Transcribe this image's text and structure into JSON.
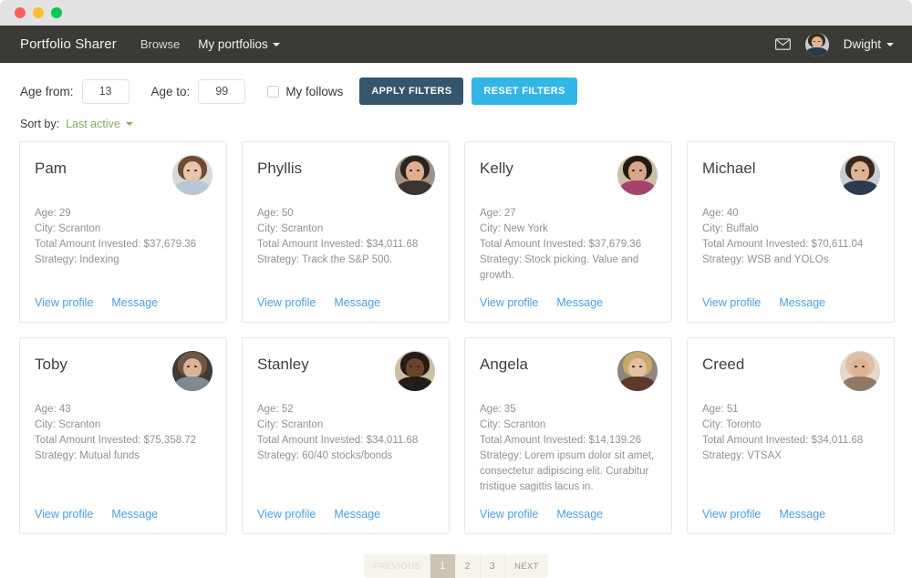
{
  "window": {
    "traffic_lights": [
      "close",
      "minimize",
      "maximize"
    ],
    "chrome_color": "#e2e2e2"
  },
  "navbar": {
    "brand": "Portfolio Sharer",
    "links": [
      {
        "label": "Browse",
        "dropdown": false
      },
      {
        "label": "My portfolios",
        "dropdown": true
      }
    ],
    "mail_icon": "envelope-icon",
    "user": "Dwight",
    "background": "#3b3a35"
  },
  "filters": {
    "age_from_label": "Age from:",
    "age_from_value": "13",
    "age_to_label": "Age to:",
    "age_to_value": "99",
    "my_follows_label": "My follows",
    "my_follows_checked": false,
    "apply_label": "APPLY FILTERS",
    "reset_label": "RESET FILTERS",
    "apply_color": "#34566f",
    "reset_color": "#33b5e5"
  },
  "sort": {
    "label": "Sort by:",
    "value": "Last active",
    "value_color": "#8aab5d"
  },
  "card_labels": {
    "view_profile": "View profile",
    "message": "Message",
    "link_color": "#4a9fe0"
  },
  "profiles": [
    {
      "name": "Pam",
      "age": "Age: 29",
      "city": "City: Scranton",
      "invested": "Total Amount Invested: $37,679.36",
      "strategy": "Strategy: Indexing",
      "avatar": {
        "hair": "#6e4b34",
        "skin": "#e8c4a8",
        "body": "#b9c6d6",
        "bg": "#d7dcd2"
      }
    },
    {
      "name": "Phyllis",
      "age": "Age: 50",
      "city": "City: Scranton",
      "invested": "Total Amount Invested: $34,011.68",
      "strategy": "Strategy: Track the S&P 500.",
      "avatar": {
        "hair": "#2a2320",
        "skin": "#dfae8f",
        "body": "#3b3330",
        "bg": "#9e9384"
      }
    },
    {
      "name": "Kelly",
      "age": "Age: 27",
      "city": "City: New York",
      "invested": "Total Amount Invested: $37,679.36",
      "strategy": "Strategy: Stock picking. Value and growth.",
      "avatar": {
        "hair": "#241a15",
        "skin": "#d7a588",
        "body": "#a4436d",
        "bg": "#cdbfa7"
      }
    },
    {
      "name": "Michael",
      "age": "Age: 40",
      "city": "City: Buffalo",
      "invested": "Total Amount Invested: $70,611.04",
      "strategy": "Strategy: WSB and YOLOs",
      "avatar": {
        "hair": "#3a2a1e",
        "skin": "#e0b494",
        "body": "#2d3a4d",
        "bg": "#c9cdd2"
      }
    },
    {
      "name": "Toby",
      "age": "Age: 43",
      "city": "City: Scranton",
      "invested": "Total Amount Invested: $75,358.72",
      "strategy": "Strategy: Mutual funds",
      "avatar": {
        "hair": "#6b5743",
        "skin": "#dcb295",
        "body": "#7e8a93",
        "bg": "#3f3a33"
      }
    },
    {
      "name": "Stanley",
      "age": "Age: 52",
      "city": "City: Scranton",
      "invested": "Total Amount Invested: $34,011.68",
      "strategy": "Strategy: 60/40 stocks/bonds",
      "avatar": {
        "hair": "#241c16",
        "skin": "#6d4428",
        "body": "#221d1a",
        "bg": "#cdbda4"
      }
    },
    {
      "name": "Angela",
      "age": "Age: 35",
      "city": "City: Scranton",
      "invested": "Total Amount Invested: $14,139.26",
      "strategy": "Strategy: Lorem ipsum dolor sit amet, consectetur adipiscing elit. Curabitur tristique sagittis lacus in.",
      "avatar": {
        "hair": "#c9a96b",
        "skin": "#e3c0a3",
        "body": "#5d3a2c",
        "bg": "#8e867c"
      }
    },
    {
      "name": "Creed",
      "age": "Age: 51",
      "city": "City: Toronto",
      "invested": "Total Amount Invested: $34,011.68",
      "strategy": "Strategy: VTSAX",
      "avatar": {
        "hair": "#dcbfa6",
        "skin": "#ddb293",
        "body": "#8e7a66",
        "bg": "#e8d9c9"
      }
    }
  ],
  "pagination": {
    "previous_label": "PREVIOUS",
    "pages": [
      "1",
      "2",
      "3"
    ],
    "active_page": "1",
    "next_label": "NEXT",
    "active_color": "#ccc5b4"
  }
}
